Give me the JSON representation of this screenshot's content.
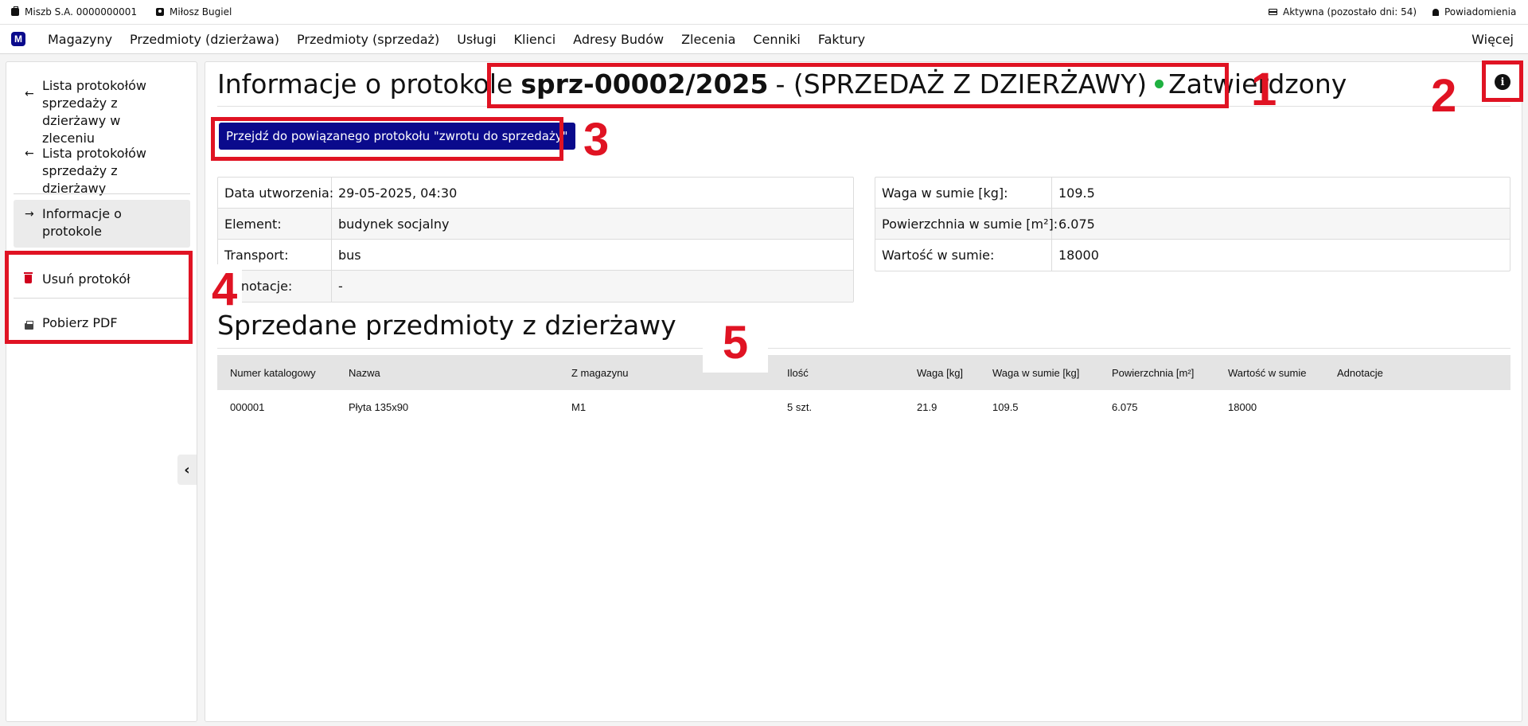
{
  "topbar": {
    "company": "Miszb S.A. 0000000001",
    "user": "Miłosz Bugiel",
    "subscription": "Aktywna (pozostało dni: 54)",
    "notifications": "Powiadomienia"
  },
  "navbar": {
    "logo": "M",
    "links": [
      "Magazyny",
      "Przedmioty (dzierżawa)",
      "Przedmioty (sprzedaż)",
      "Usługi",
      "Klienci",
      "Adresy Budów",
      "Zlecenia",
      "Cenniki",
      "Faktury"
    ],
    "more": "Więcej"
  },
  "sidebar": {
    "items": [
      {
        "arrow": "←",
        "label": "Lista protokołów sprzedaży z dzierżawy w zleceniu"
      },
      {
        "arrow": "←",
        "label": "Lista protokołów sprzedaży z dzierżawy"
      },
      {
        "arrow": "→",
        "label": "Informacje o protokole"
      },
      {
        "label": "Usuń protokół",
        "icon": "trash-icon"
      },
      {
        "label": "Pobierz PDF",
        "icon": "printer-icon"
      }
    ],
    "collapse": "‹"
  },
  "header": {
    "prefix": "Informacje o protokole",
    "number": "sprz-00002/2025",
    "type": "- (SPRZEDAŻ Z DZIERŻAWY)",
    "status": "Zatwierdzony",
    "status_color": "#1fb141",
    "info_icon": "i"
  },
  "link_button": "Przejdź do powiązanego protokołu \"zwrotu do sprzedaży\"",
  "details_left": [
    {
      "key": "Data utworzenia:",
      "value": "29-05-2025, 04:30"
    },
    {
      "key": "Element:",
      "value": "budynek socjalny"
    },
    {
      "key": "Transport:",
      "value": "bus"
    },
    {
      "key": "Adnotacje:",
      "value": "-"
    }
  ],
  "details_right": [
    {
      "key": "Waga w sumie [kg]:",
      "value": "109.5"
    },
    {
      "key": "Powierzchnia w sumie [m²]:",
      "value": "6.075"
    },
    {
      "key": "Wartość w sumie:",
      "value": "18000"
    }
  ],
  "section_title": "Sprzedane przedmioty z dzierżawy",
  "table": {
    "headers": [
      "Numer katalogowy",
      "Nazwa",
      "Z magazynu",
      "Ilość",
      "Waga [kg]",
      "Waga w sumie [kg]",
      "Powierzchnia [m²]",
      "Wartość w sumie",
      "Adnotacje"
    ],
    "rows": [
      [
        "000001",
        "Płyta 135x90",
        "M1",
        "5 szt.",
        "21.9",
        "109.5",
        "6.075",
        "18000",
        ""
      ]
    ]
  },
  "annotations": [
    "1",
    "2",
    "3",
    "4",
    "5"
  ],
  "colors": {
    "brand": "#0a0a8c",
    "annotation": "#e01323",
    "danger": "#d0001c"
  }
}
